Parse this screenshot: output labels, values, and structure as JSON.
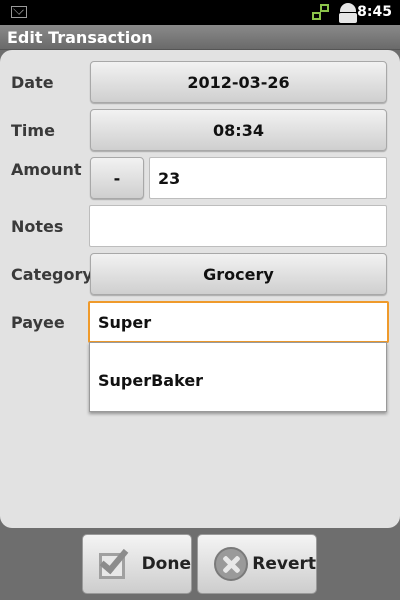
{
  "status_bar": {
    "time": "8:45",
    "icons": [
      "mail-icon",
      "network-sync-icon",
      "android-icon"
    ]
  },
  "app": {
    "title": "Edit Transaction"
  },
  "form": {
    "date_label": "Date",
    "date_value": "2012-03-26",
    "time_label": "Time",
    "time_value": "08:34",
    "amount_label": "Amount",
    "amount_sign": "-",
    "amount_value": "23",
    "notes_label": "Notes",
    "notes_value": "",
    "category_label": "Category",
    "category_value": "Grocery",
    "payee_label": "Payee",
    "payee_value": "Super",
    "payee_suggestions": [
      "SuperBaker"
    ]
  },
  "actions": {
    "done_label": "Done",
    "revert_label": "Revert"
  },
  "colors": {
    "focus_border": "#ef9a2b",
    "panel_bg": "#e2e2e2",
    "chrome_bg": "#6e6e6e",
    "network_icon": "#8bc34a"
  }
}
